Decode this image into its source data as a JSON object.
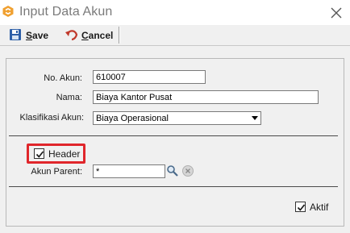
{
  "window": {
    "title": "Input Data Akun"
  },
  "toolbar": {
    "save_label": "Save",
    "cancel_label": "Cancel"
  },
  "form": {
    "no_akun_label": "No. Akun:",
    "no_akun_value": "610007",
    "nama_label": "Nama:",
    "nama_value": "Biaya Kantor Pusat",
    "klasifikasi_label": "Klasifikasi Akun:",
    "klasifikasi_value": "Biaya Operasional",
    "header_label": "Header",
    "header_checked": true,
    "akun_parent_label": "Akun Parent:",
    "akun_parent_value": "*",
    "aktif_label": "Aktif",
    "aktif_checked": true
  },
  "colors": {
    "highlight": "#e0262b",
    "app_icon": "#f0a030"
  },
  "icons": {
    "app": "app-logo-icon",
    "close": "close-icon",
    "save": "save-icon",
    "cancel": "undo-icon",
    "search": "search-icon",
    "clear": "clear-icon"
  }
}
